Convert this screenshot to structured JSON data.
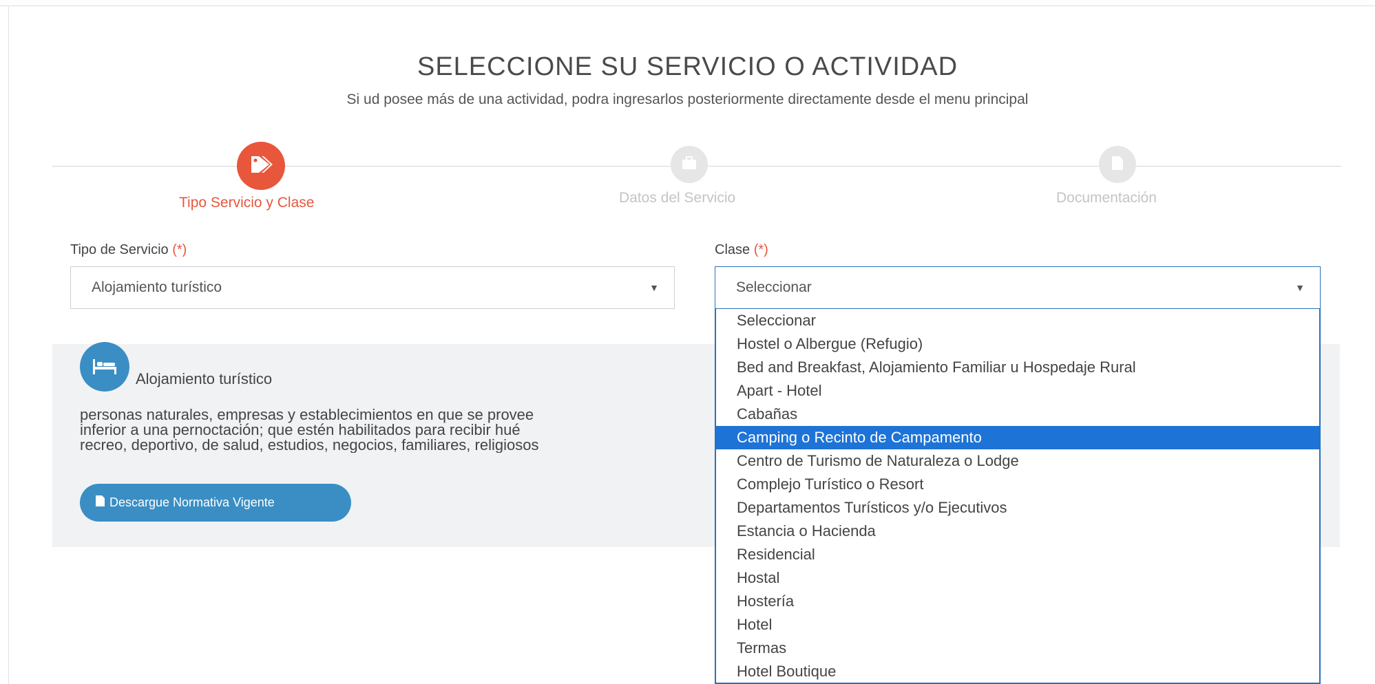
{
  "header": {
    "title": "SELECCIONE SU SERVICIO O ACTIVIDAD",
    "subtitle": "Si ud posee más de una actividad, podra ingresarlos posteriormente directamente desde el menu principal"
  },
  "steps": [
    {
      "label": "Tipo Servicio y Clase",
      "icon": "tag-icon",
      "active": true
    },
    {
      "label": "Datos del Servicio",
      "icon": "briefcase-icon",
      "active": false
    },
    {
      "label": "Documentación",
      "icon": "document-icon",
      "active": false
    }
  ],
  "form": {
    "tipo_label": "Tipo de Servicio",
    "clase_label": "Clase",
    "required_mark": "(*)",
    "tipo_value": "Alojamiento turístico",
    "clase_value": "Seleccionar"
  },
  "dropdown": {
    "highlighted": "Camping o Recinto de Campamento",
    "options": [
      "Seleccionar",
      "Hostel o Albergue (Refugio)",
      "Bed and Breakfast, Alojamiento Familiar u Hospedaje Rural",
      "Apart - Hotel",
      "Cabañas",
      "Camping o Recinto de Campamento",
      "Centro de Turismo de Naturaleza o Lodge",
      "Complejo Turístico o Resort",
      "Departamentos Turísticos y/o Ejecutivos",
      "Estancia o Hacienda",
      "Residencial",
      "Hostal",
      "Hostería",
      "Hotel",
      "Termas",
      "Hotel Boutique"
    ]
  },
  "info": {
    "icon": "bed-icon",
    "title": "Alojamiento turístico",
    "lines": [
      "personas naturales, empresas y establecimientos en que se provee",
      "inferior a una pernoctación; que estén habilitados para recibir hué",
      "recreo, deportivo, de salud, estudios, negocios, familiares, religiosos"
    ],
    "download_label": "Descargue Normativa Vigente"
  },
  "colors": {
    "accent": "#e8563c",
    "primary": "#3a8ec4",
    "highlight": "#1e73d6"
  }
}
